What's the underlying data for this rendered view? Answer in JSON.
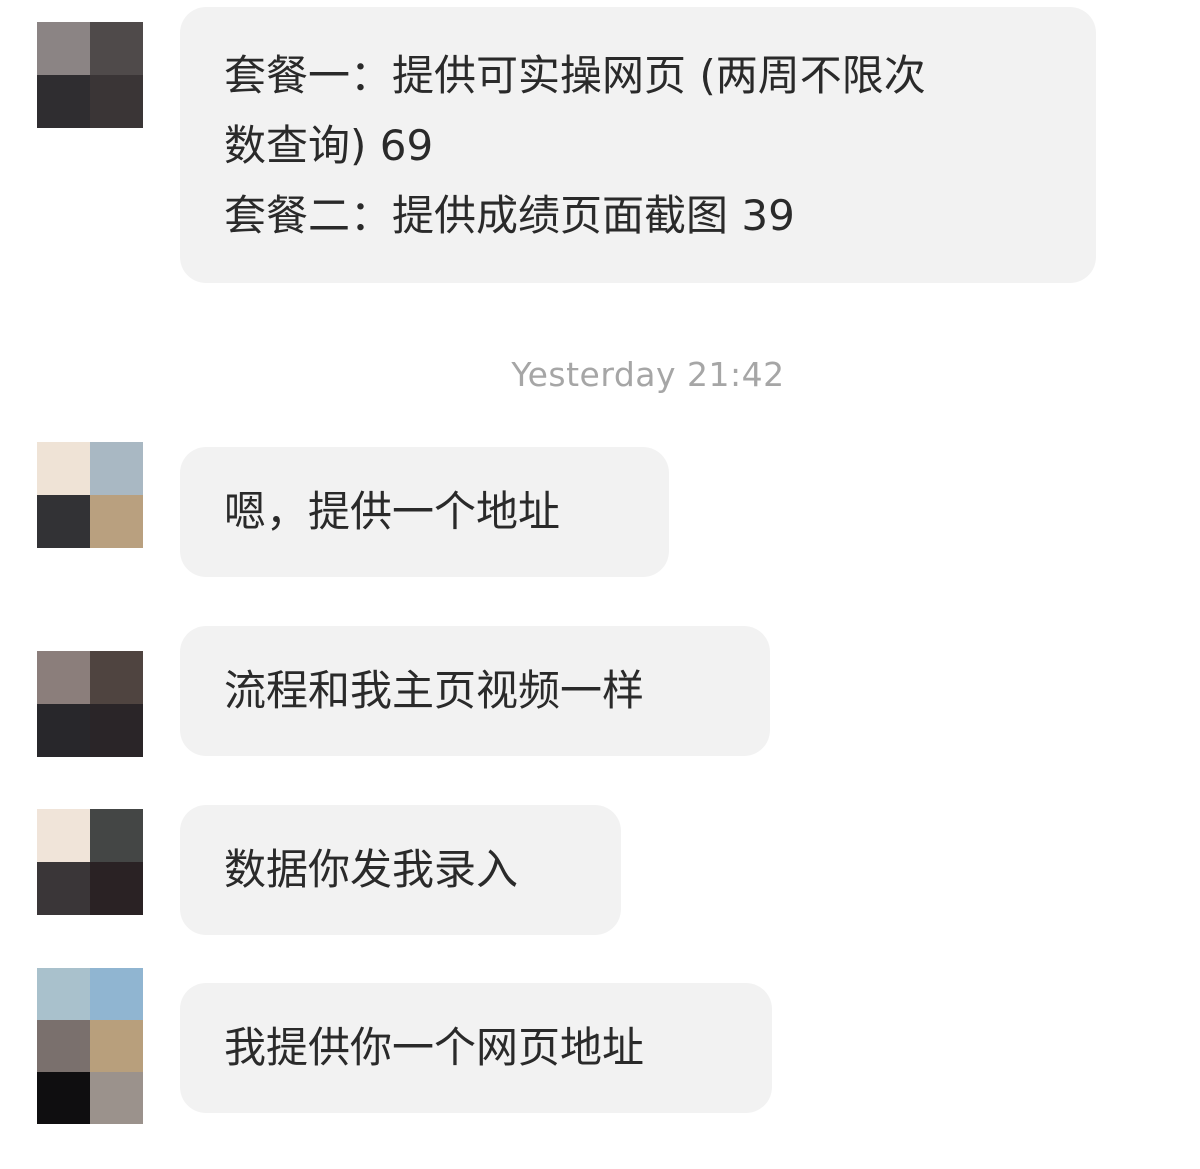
{
  "messages": [
    {
      "lines": [
        "套餐一：提供可实操网页 (两周不限次",
        "数查询) 69",
        "套餐二：提供成绩页面截图 39"
      ],
      "avatar_colors": [
        "#8b8484",
        "#4f4a4a",
        "#2f2d30",
        "#3a3536"
      ]
    },
    {
      "lines": [
        "嗯，提供一个地址"
      ],
      "avatar_colors": [
        "#efe3d6",
        "#a9b8c3",
        "#323235",
        "#b9a07f"
      ]
    },
    {
      "lines": [
        "流程和我主页视频一样"
      ],
      "avatar_colors": [
        "#8b7e7b",
        "#4f4440",
        "#28272b",
        "#2a2528"
      ]
    },
    {
      "lines": [
        "数据你发我录入"
      ],
      "avatar_colors": [
        "#f0e4d9",
        "#444645",
        "#3a3638",
        "#2a2224"
      ]
    },
    {
      "lines": [
        "我提供你一个网页地址"
      ],
      "avatar_colors": [
        "#a9c1cc",
        "#90b5d1",
        "#7a706d",
        "#b89f7c",
        "#0f0e10",
        "#9b928c"
      ]
    }
  ],
  "timestamp": "Yesterday 21:42"
}
